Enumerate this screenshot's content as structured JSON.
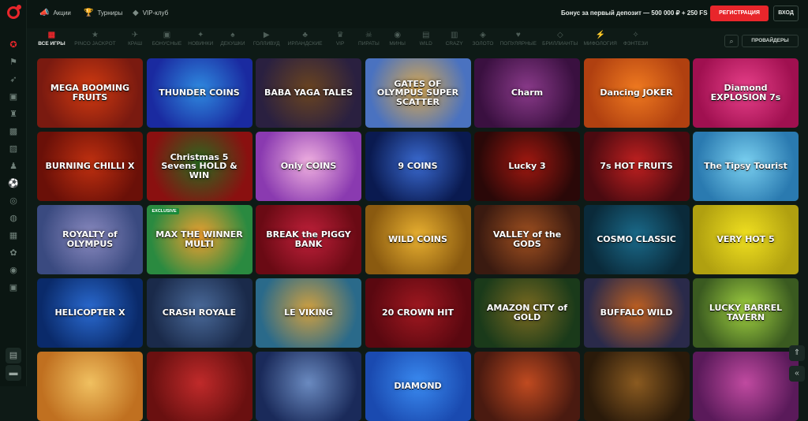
{
  "topbar": {
    "links": [
      {
        "label": "Акции",
        "icon": "megaphone-icon",
        "glyph": "📣"
      },
      {
        "label": "Турниры",
        "icon": "trophy-icon",
        "glyph": "🏆"
      },
      {
        "label": "VIP-клуб",
        "icon": "diamond-icon",
        "glyph": "◆"
      }
    ],
    "bonus_text": "Бонус за первый депозит — 500 000 ₽ + 250 FS",
    "register_label": "РЕГИСТРАЦИЯ",
    "login_label": "ВХОД"
  },
  "categories": [
    {
      "label": "ВСЕ ИГРЫ",
      "glyph": "▦",
      "active": true
    },
    {
      "label": "PINCO JACKPOT",
      "glyph": "★"
    },
    {
      "label": "КРАШ",
      "glyph": "✈"
    },
    {
      "label": "БОНУСНЫЕ",
      "glyph": "▣"
    },
    {
      "label": "НОВИНКИ",
      "glyph": "✦"
    },
    {
      "label": "ДЕКУШКИ",
      "glyph": "♠"
    },
    {
      "label": "ГОЛЛИВУД",
      "glyph": "▶"
    },
    {
      "label": "ИРЛАНДСКИЕ",
      "glyph": "♣"
    },
    {
      "label": "VIP",
      "glyph": "♛"
    },
    {
      "label": "ПИРАТЫ",
      "glyph": "☠"
    },
    {
      "label": "МИНЫ",
      "glyph": "◉"
    },
    {
      "label": "WILD",
      "glyph": "▤"
    },
    {
      "label": "CRAZY",
      "glyph": "▥"
    },
    {
      "label": "ЗОЛОТО",
      "glyph": "◈"
    },
    {
      "label": "ПОПУЛЯРНЫЕ",
      "glyph": "♥"
    },
    {
      "label": "БРИЛЛИАНТЫ",
      "glyph": "◇"
    },
    {
      "label": "МИФОЛОГИЯ",
      "glyph": "⚡"
    },
    {
      "label": "ФЭНТЕЗИ",
      "glyph": "✧"
    }
  ],
  "providers_label": "ПРОВАЙДЕРЫ",
  "sidebar_icons": [
    "casino-icon",
    "sports-icon",
    "rocket-icon",
    "live-icon",
    "table-games-icon",
    "cards-icon",
    "tickets-icon",
    "user-icon",
    "football-icon",
    "esports-icon",
    "virtual-icon",
    "lottery-icon",
    "promo-icon",
    "support-icon",
    "gift-icon"
  ],
  "games": [
    {
      "title": "MEGA BOOMING FRUITS",
      "bg": "#7a1a10",
      "bg2": "#d23a10"
    },
    {
      "title": "THUNDER COINS",
      "bg": "#1a2aa0",
      "bg2": "#2f8ae0"
    },
    {
      "title": "BABA YAGA TALES",
      "bg": "#2a2040",
      "bg2": "#6a4420"
    },
    {
      "title": "GATES OF OLYMPUS SUPER SCATTER",
      "bg": "#4a72c0",
      "bg2": "#d8a850"
    },
    {
      "title": "Charm",
      "bg": "#3a1040",
      "bg2": "#8a3a8a"
    },
    {
      "title": "Dancing JOKER",
      "bg": "#b04010",
      "bg2": "#f07a20"
    },
    {
      "title": "Diamond EXPLOSION 7s",
      "bg": "#a01050",
      "bg2": "#e8408a"
    },
    {
      "title": "BURNING CHILLI X",
      "bg": "#6a1008",
      "bg2": "#c03010"
    },
    {
      "title": "Christmas 5 Sevens HOLD & WIN",
      "bg": "#8a1010",
      "bg2": "#2a6a20"
    },
    {
      "title": "Only COINS",
      "bg": "#8a3ab0",
      "bg2": "#f0b0e0"
    },
    {
      "title": "9 COINS",
      "bg": "#0a1a50",
      "bg2": "#3a6ad0"
    },
    {
      "title": "Lucky 3",
      "bg": "#2a0808",
      "bg2": "#a01810"
    },
    {
      "title": "7s HOT FRUITS",
      "bg": "#4a0a10",
      "bg2": "#c02020"
    },
    {
      "title": "The Tipsy Tourist",
      "bg": "#2a7ab0",
      "bg2": "#7ad0f0"
    },
    {
      "title": "ROYALTY of OLYMPUS",
      "bg": "#3a4a80",
      "bg2": "#8a8ac0"
    },
    {
      "title": "MAX THE WINNER MULTI",
      "bg": "#2a8a40",
      "bg2": "#f0a030",
      "badge": "EXCLUSIVE"
    },
    {
      "title": "BREAK the PIGGY BANK",
      "bg": "#6a0a14",
      "bg2": "#c0203a"
    },
    {
      "title": "WILD COINS",
      "bg": "#8a5a10",
      "bg2": "#e8b030"
    },
    {
      "title": "VALLEY of the GODS",
      "bg": "#3a1a10",
      "bg2": "#a05020"
    },
    {
      "title": "COSMO CLASSIC",
      "bg": "#0a2a3a",
      "bg2": "#1a6a8a"
    },
    {
      "title": "VERY HOT 5",
      "bg": "#b0a010",
      "bg2": "#f0e020"
    },
    {
      "title": "HELICOPTER X",
      "bg": "#0a2a6a",
      "bg2": "#2a6ad0"
    },
    {
      "title": "CRASH ROYALE",
      "bg": "#1a2a4a",
      "bg2": "#4a6a9a"
    },
    {
      "title": "LE VIKING",
      "bg": "#2a6a8a",
      "bg2": "#d0a040"
    },
    {
      "title": "20 CROWN HIT",
      "bg": "#5a0810",
      "bg2": "#a01820"
    },
    {
      "title": "AMAZON CITY of GOLD",
      "bg": "#1a3a1a",
      "bg2": "#7a6a20"
    },
    {
      "title": "BUFFALO WILD",
      "bg": "#2a2a4a",
      "bg2": "#c06020"
    },
    {
      "title": "LUCKY BARREL TAVERN",
      "bg": "#3a5a20",
      "bg2": "#a0d040"
    },
    {
      "title": "",
      "bg": "#c07020",
      "bg2": "#f0c060"
    },
    {
      "title": "",
      "bg": "#6a1010",
      "bg2": "#c02a2a"
    },
    {
      "title": "",
      "bg": "#1a2a5a",
      "bg2": "#6a8ac0"
    },
    {
      "title": "DIAMOND",
      "bg": "#1a4ab0",
      "bg2": "#3a8af0"
    },
    {
      "title": "",
      "bg": "#4a1a10",
      "bg2": "#c04a20"
    },
    {
      "title": "",
      "bg": "#2a1a0a",
      "bg2": "#8a5a20"
    },
    {
      "title": "",
      "bg": "#5a1a5a",
      "bg2": "#c04aa0"
    }
  ]
}
